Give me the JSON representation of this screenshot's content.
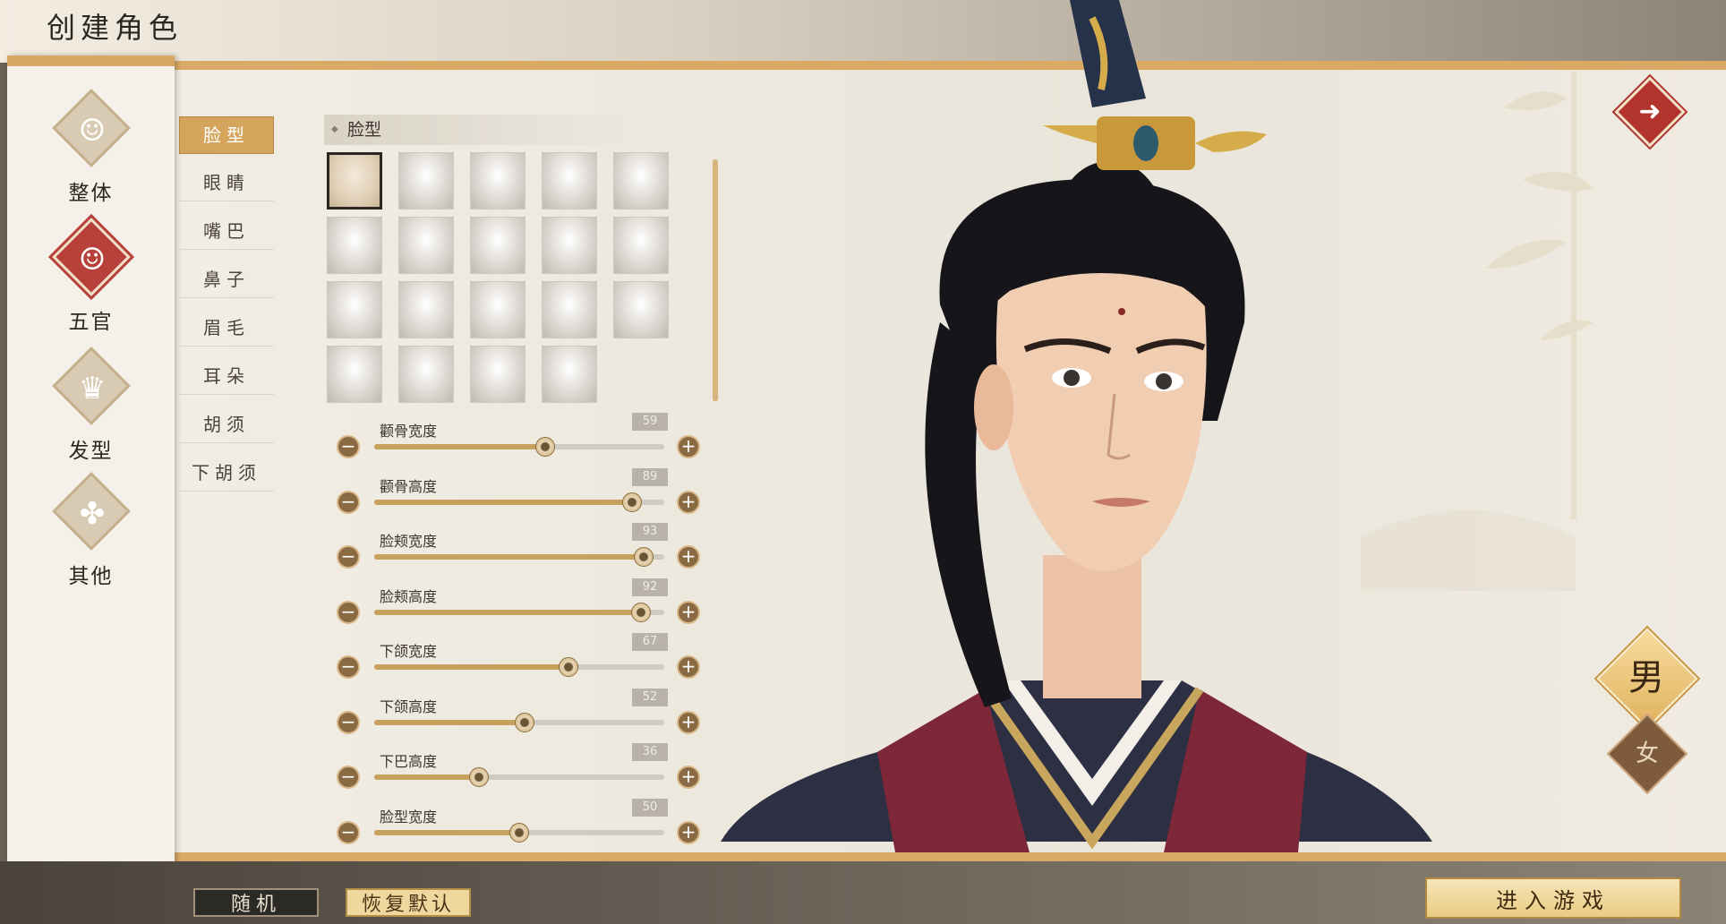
{
  "title": "创建角色",
  "categories": [
    {
      "label": "整体",
      "icon": "face-outline-icon"
    },
    {
      "label": "五官",
      "icon": "face-features-icon",
      "active": true
    },
    {
      "label": "发型",
      "icon": "hairstyle-icon"
    },
    {
      "label": "其他",
      "icon": "clover-icon"
    }
  ],
  "subcategories": [
    "脸型",
    "眼睛",
    "嘴巴",
    "鼻子",
    "眉毛",
    "耳朵",
    "胡须",
    "下胡须"
  ],
  "active_sub": "脸型",
  "section_title": "脸型",
  "preset_count": 19,
  "selected_preset": 0,
  "sliders": [
    {
      "label": "颧骨宽度",
      "value": 59
    },
    {
      "label": "颧骨高度",
      "value": 89
    },
    {
      "label": "脸颊宽度",
      "value": 93
    },
    {
      "label": "脸颊高度",
      "value": 92
    },
    {
      "label": "下颌宽度",
      "value": 67
    },
    {
      "label": "下颌高度",
      "value": 52
    },
    {
      "label": "下巴高度",
      "value": 36
    },
    {
      "label": "脸型宽度",
      "value": 50
    }
  ],
  "gender": {
    "male_label": "男",
    "female_label": "女"
  },
  "buttons": {
    "random": "随机",
    "reset": "恢复默认",
    "enter": "进入游戏"
  },
  "colors": {
    "accent": "#d5a55e",
    "active_red": "#b8403a"
  }
}
